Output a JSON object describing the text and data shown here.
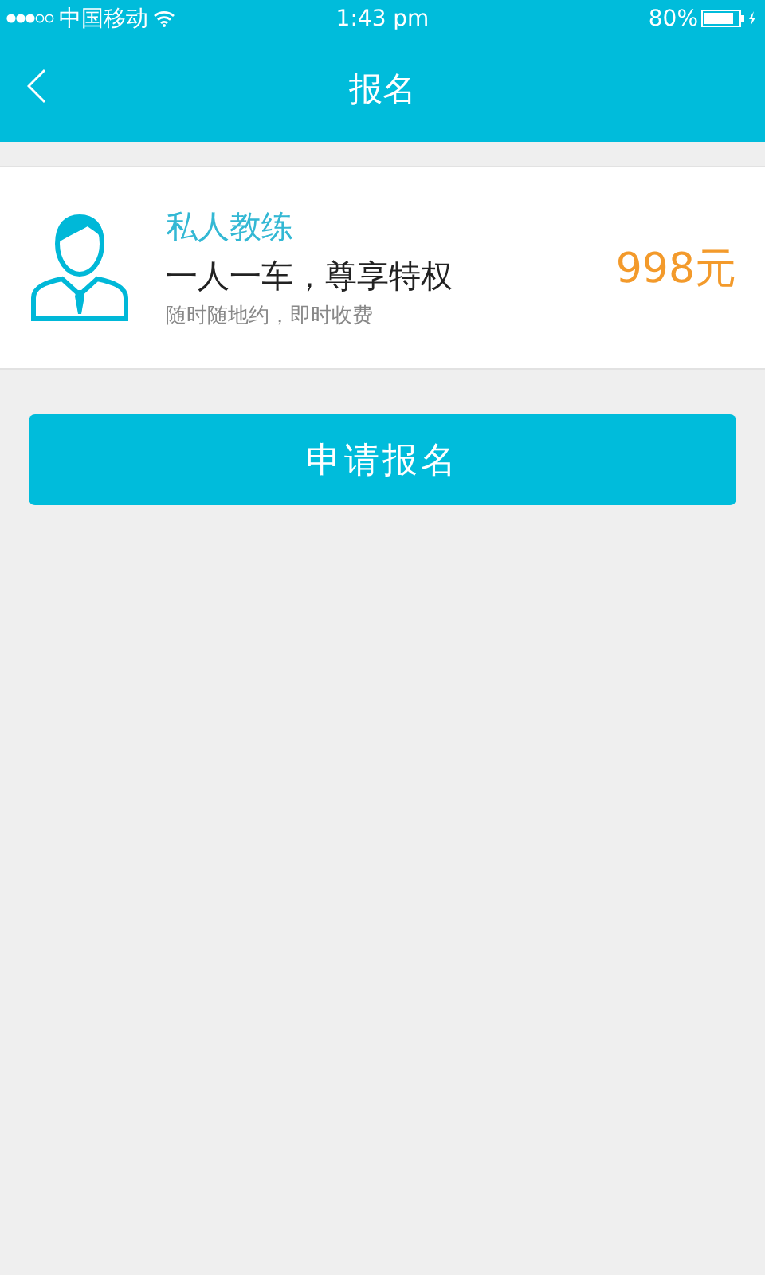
{
  "status_bar": {
    "carrier": "中国移动",
    "time": "1:43 pm",
    "battery": "80%"
  },
  "nav_bar": {
    "title": "报名"
  },
  "plan": {
    "name": "私人教练",
    "headline": "一人一车，尊享特权",
    "note": "随时随地约，即时收费",
    "price": "998元"
  },
  "primary_button": {
    "label": "申请报名"
  }
}
